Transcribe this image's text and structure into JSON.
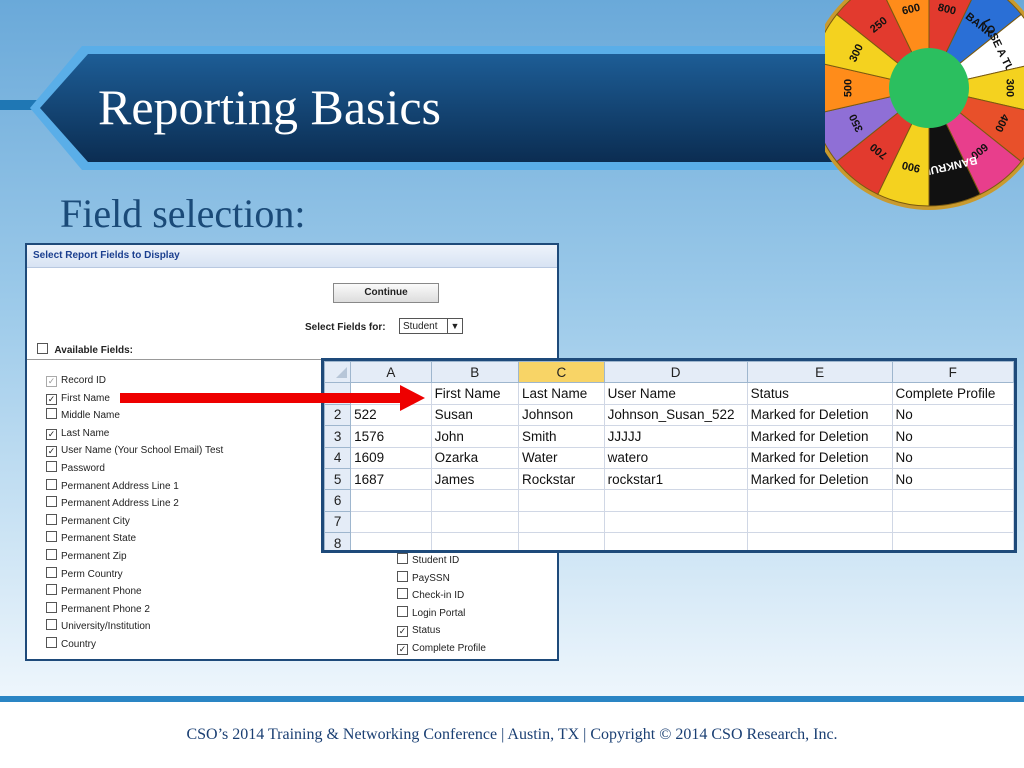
{
  "slide": {
    "title": "Reporting Basics",
    "subtitle": "Field selection:",
    "footer": "CSO’s 2014 Training & Networking Conference   |   Austin, TX   | Copyright © 2014 CSO Research, Inc."
  },
  "wheel": {
    "labels": [
      "800",
      "BANK",
      "LOSE A TURN",
      "300",
      "400",
      "600",
      "BANKRUPT",
      "900",
      "700",
      "350",
      "500",
      "300",
      "250",
      "600"
    ],
    "colors": [
      "#e23a2e",
      "#2a6fd6",
      "#ffffff",
      "#f4d21f",
      "#e8502a",
      "#e83e8c",
      "#111111",
      "#f4d21f",
      "#e23a2e",
      "#8f6fd6",
      "#ff8c1a",
      "#f4d21f",
      "#e23a2e",
      "#ff8c1a"
    ]
  },
  "report_panel": {
    "header": "Select Report Fields to Display",
    "continue_label": "Continue",
    "select_fields_label": "Select Fields for:",
    "select_value": "Student",
    "available_label": "Available Fields:",
    "fields": [
      {
        "label": "Record ID",
        "checked": true,
        "disabled": true
      },
      {
        "label": "First Name",
        "checked": true
      },
      {
        "label": "Middle Name",
        "checked": false
      },
      {
        "label": "Last Name",
        "checked": true
      },
      {
        "label": "User Name (Your School Email) Test",
        "checked": true
      },
      {
        "label": "Password",
        "checked": false
      },
      {
        "label": "Permanent Address Line 1",
        "checked": false
      },
      {
        "label": "Permanent Address Line 2",
        "checked": false
      },
      {
        "label": "Permanent City",
        "checked": false
      },
      {
        "label": "Permanent State",
        "checked": false
      },
      {
        "label": "Permanent Zip",
        "checked": false
      },
      {
        "label": "Perm Country",
        "checked": false
      },
      {
        "label": "Permanent Phone",
        "checked": false
      },
      {
        "label": "Permanent Phone 2",
        "checked": false
      },
      {
        "label": "University/Institution",
        "checked": false
      },
      {
        "label": "Country",
        "checked": false
      }
    ],
    "fields_col2": [
      {
        "label": "Student ID",
        "checked": false
      },
      {
        "label": "PaySSN",
        "checked": false
      },
      {
        "label": "Check-in ID",
        "checked": false
      },
      {
        "label": "Login Portal",
        "checked": false
      },
      {
        "label": "Status",
        "checked": true
      },
      {
        "label": "Complete Profile",
        "checked": true
      }
    ]
  },
  "spreadsheet": {
    "columns": [
      "A",
      "B",
      "C",
      "D",
      "E",
      "F"
    ],
    "selected_column": "C",
    "header_row": [
      "",
      "First Name",
      "Last Name",
      "User Name",
      "Status",
      "Complete Profile"
    ],
    "rows": [
      {
        "num": "2",
        "cells": [
          "522",
          "Susan",
          "Johnson",
          "Johnson_Susan_522",
          "Marked for Deletion",
          "No"
        ]
      },
      {
        "num": "3",
        "cells": [
          "1576",
          "John",
          "Smith",
          "JJJJJ",
          "Marked for Deletion",
          "No"
        ]
      },
      {
        "num": "4",
        "cells": [
          "1609",
          "Ozarka",
          "Water",
          "watero",
          "Marked for Deletion",
          "No"
        ]
      },
      {
        "num": "5",
        "cells": [
          "1687",
          "James",
          "Rockstar",
          "rockstar1",
          "Marked for Deletion",
          "No"
        ]
      },
      {
        "num": "6",
        "cells": [
          "",
          "",
          "",
          "",
          "",
          ""
        ]
      },
      {
        "num": "7",
        "cells": [
          "",
          "",
          "",
          "",
          "",
          ""
        ]
      },
      {
        "num": "8",
        "cells": [
          "",
          "",
          "",
          "",
          "",
          ""
        ]
      }
    ]
  },
  "colors": {
    "banner_dark": "#0f3a66",
    "banner_border": "#4fa3e0",
    "arrow": "#ee0000",
    "selected_column": "#f8d466"
  }
}
